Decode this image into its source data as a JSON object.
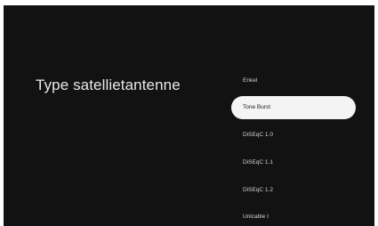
{
  "page": {
    "title": "Type satellietantenne"
  },
  "options": [
    {
      "label": "Enkel",
      "selected": false
    },
    {
      "label": "Tone Burst",
      "selected": true
    },
    {
      "label": "DiSEqC 1.0",
      "selected": false
    },
    {
      "label": "DiSEqC 1.1",
      "selected": false
    },
    {
      "label": "DiSEqC 1.2",
      "selected": false
    },
    {
      "label": "Unicable I",
      "selected": false
    }
  ],
  "colors": {
    "background": "#121212",
    "text": "#e8e8e8",
    "selected_background": "#f4f4f4",
    "selected_text": "#202020"
  }
}
